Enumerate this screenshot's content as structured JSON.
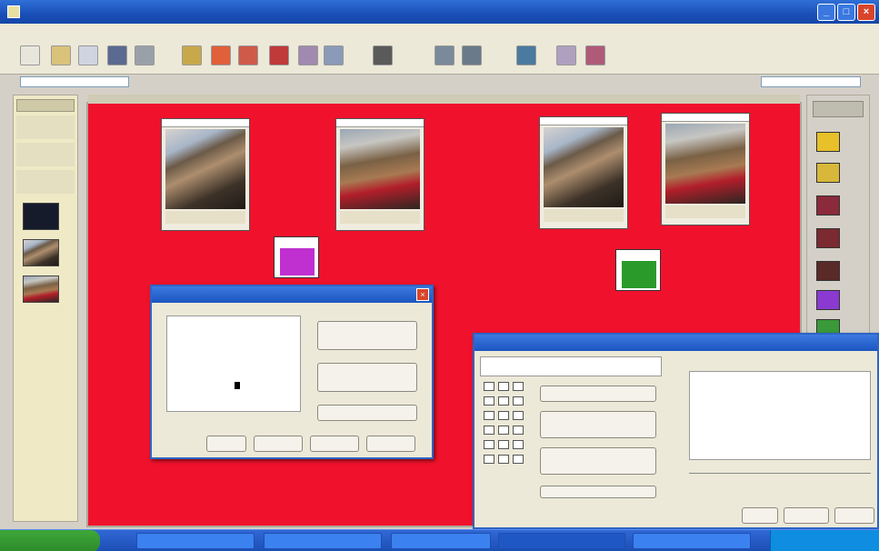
{
  "window": {
    "title": "",
    "min_label": "_",
    "max_label": "□",
    "close_label": "×"
  },
  "menu": {
    "items": [
      "",
      "",
      "",
      "",
      "",
      "",
      "",
      ""
    ]
  },
  "toolbar": {
    "buttons": [
      "",
      "",
      "",
      "",
      "",
      "",
      "",
      "",
      "",
      "",
      "",
      "",
      "",
      "",
      "",
      "",
      "",
      ""
    ]
  },
  "canvas": {
    "title": ""
  },
  "nodes": [
    {
      "caption": ""
    },
    {
      "caption": ""
    },
    {
      "caption": ""
    },
    {
      "caption": ""
    }
  ],
  "right_panel": {
    "buttons": [
      {
        "color": "#e8c02a"
      },
      {
        "color": "#d8b83a"
      },
      {
        "color": "#8a2a3a"
      },
      {
        "color": "#7a2a30"
      },
      {
        "color": "#5a2a28"
      },
      {
        "color": "#8a3ad0"
      },
      {
        "color": "#3a9a3a"
      }
    ]
  },
  "dialog1": {
    "title": "",
    "buttons": [
      "",
      "",
      ""
    ],
    "footer_buttons": [
      "",
      "",
      "",
      ""
    ]
  },
  "dialog2": {
    "title": "",
    "chart_title": "",
    "buttons": [
      "",
      "",
      "",
      ""
    ],
    "footer_buttons": [
      "",
      "",
      ""
    ]
  },
  "taskbar": {
    "start_label": "",
    "tasks": [
      "",
      "",
      "",
      "",
      "",
      ""
    ],
    "clock": ""
  },
  "colors": {
    "canvas": "#f0122c",
    "filter_purple": "#c030d0",
    "filter_green": "#2a9a2a",
    "titlebar": "#1a4fb8"
  }
}
